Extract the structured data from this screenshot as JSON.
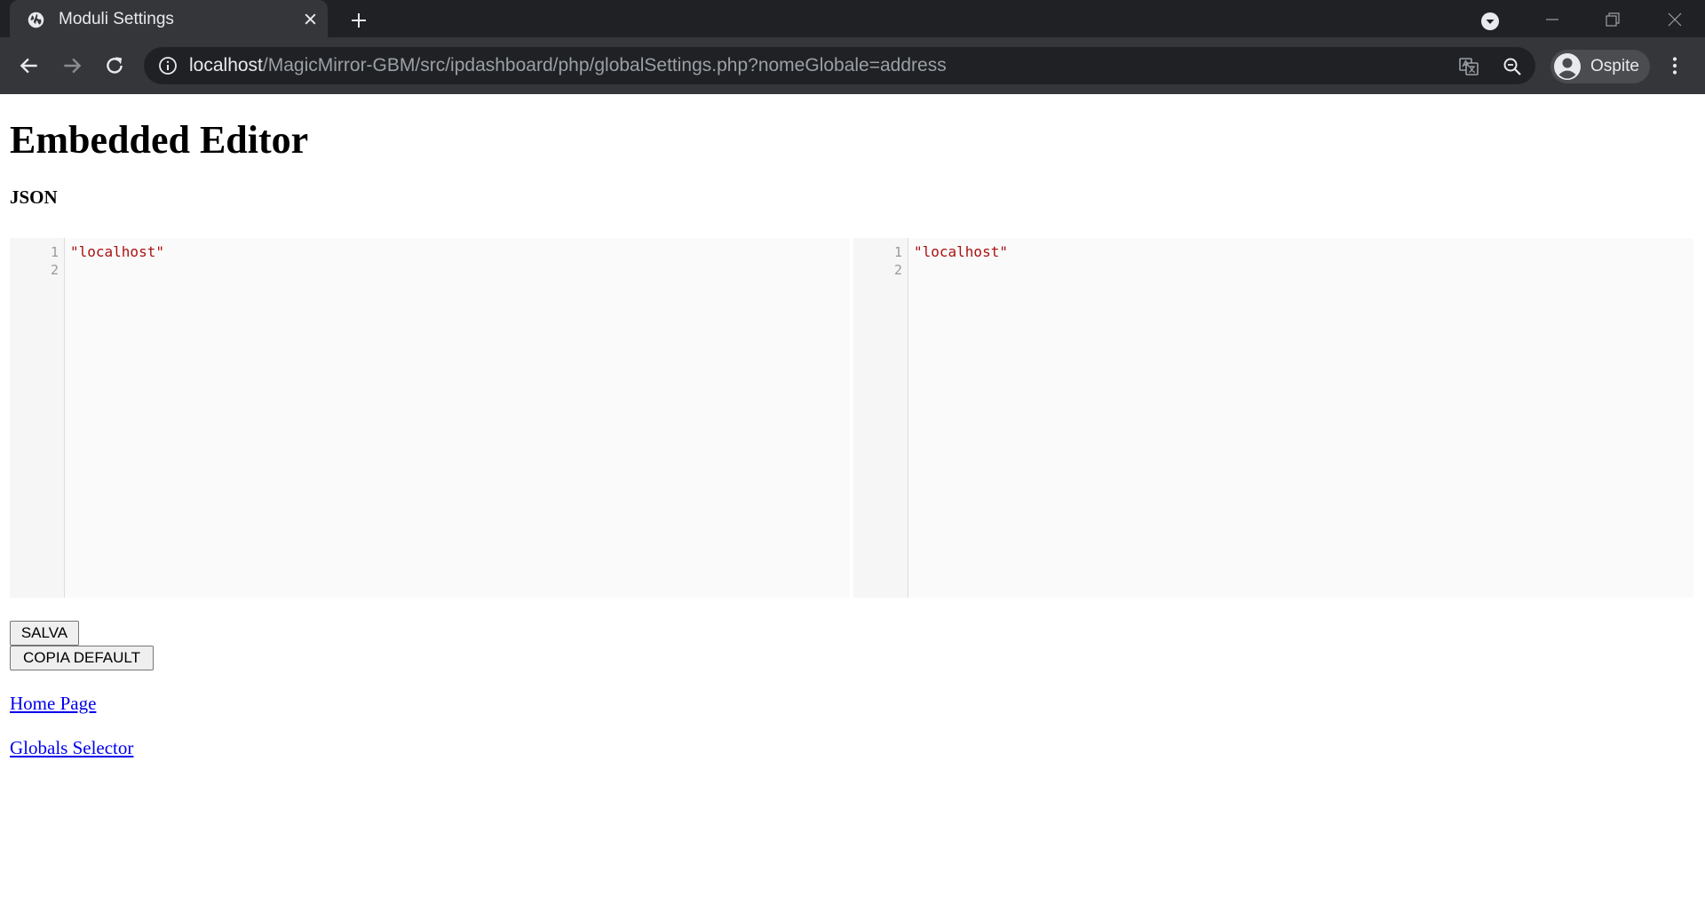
{
  "browser": {
    "tab_title": "Moduli Settings",
    "url_host": "localhost",
    "url_path": "/MagicMirror-GBM/src/ipdashboard/php/globalSettings.php?nomeGlobale=address",
    "profile_name": "Ospite",
    "icons": [
      "globe-icon",
      "close-icon",
      "plus-icon",
      "tab-search-icon",
      "minimize-icon",
      "restore-icon",
      "window-close-icon",
      "back-arrow-icon",
      "forward-arrow-icon",
      "reload-icon",
      "info-icon",
      "translate-icon",
      "zoom-out-icon",
      "avatar-icon",
      "more-menu-icon"
    ]
  },
  "page": {
    "title": "Embedded Editor",
    "section_label": "JSON"
  },
  "editors": {
    "left": {
      "line_numbers": [
        "1",
        "2"
      ],
      "lines": [
        "\"localhost\"",
        ""
      ]
    },
    "right": {
      "line_numbers": [
        "1",
        "2"
      ],
      "lines": [
        "\"localhost\"",
        ""
      ]
    }
  },
  "buttons": {
    "save_label": "SALVA",
    "copy_default_label": "COPIA DEFAULT"
  },
  "links": {
    "home": "Home Page",
    "globals": "Globals Selector"
  },
  "colors": {
    "link": "#0000ee",
    "json_string": "#aa1111",
    "tabstrip": "#202124",
    "toolbar": "#35363a"
  }
}
